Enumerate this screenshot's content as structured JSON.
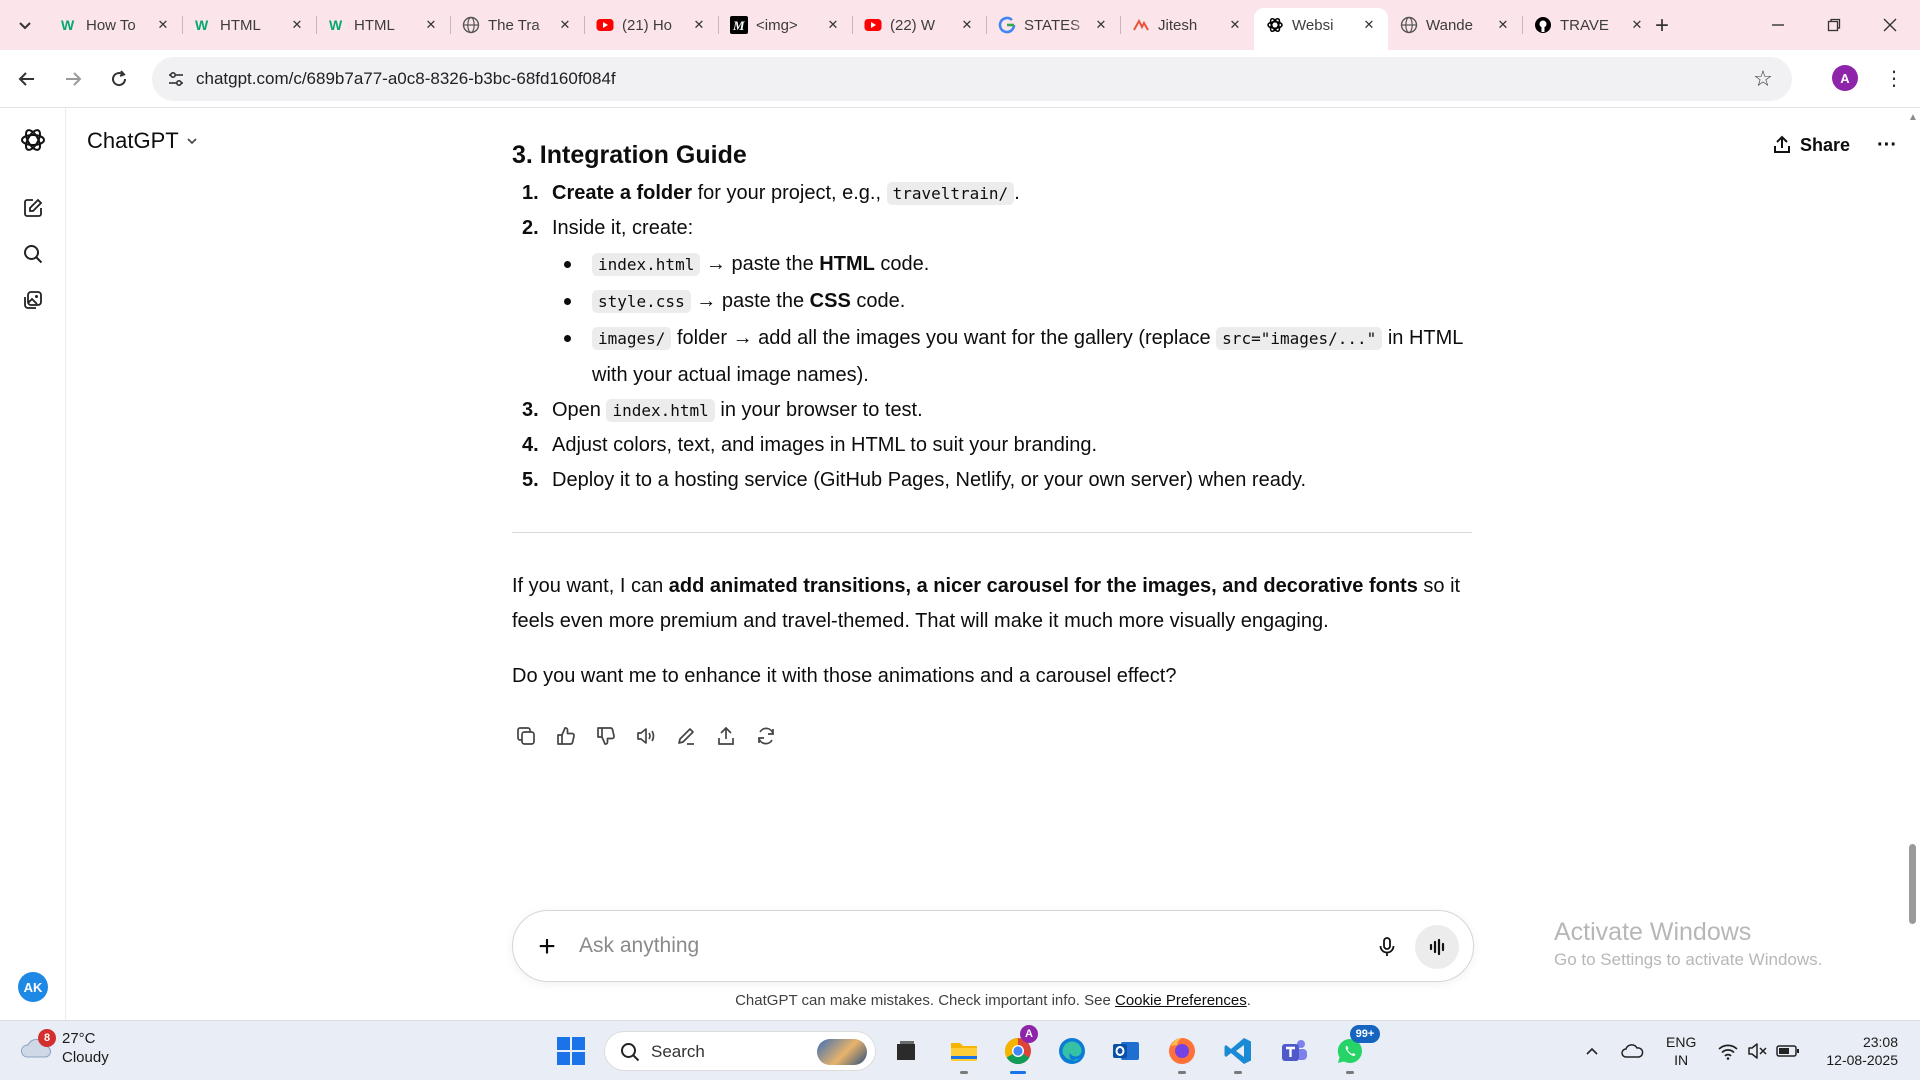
{
  "browser": {
    "tabs": [
      {
        "title": "How To",
        "favicon": "w3schools-icon",
        "color": "#04aa6d"
      },
      {
        "title": "HTML",
        "favicon": "w3schools-icon",
        "color": "#04aa6d"
      },
      {
        "title": "HTML",
        "favicon": "w3schools-icon",
        "color": "#04aa6d"
      },
      {
        "title": "The Tra",
        "favicon": "globe-icon",
        "color": "#555555"
      },
      {
        "title": "(21) Ho",
        "favicon": "youtube-icon",
        "color": "#ff0000"
      },
      {
        "title": "<img>",
        "favicon": "m-logo-icon",
        "color": "#000000"
      },
      {
        "title": "(22) W",
        "favicon": "youtube-icon",
        "color": "#ff0000"
      },
      {
        "title": "STATES",
        "favicon": "google-icon",
        "color": "#4285f4"
      },
      {
        "title": "Jitesh",
        "favicon": "wave-logo-icon",
        "color": "#e8553a"
      },
      {
        "title": "Websi",
        "favicon": "chatgpt-icon",
        "color": "#000000",
        "active": true
      },
      {
        "title": "Wande",
        "favicon": "globe-icon",
        "color": "#555555"
      },
      {
        "title": "TRAVE",
        "favicon": "github-icon",
        "color": "#000000"
      }
    ],
    "url": "chatgpt.com/c/689b7a77-a0c8-8326-b3bc-68fd160f084f",
    "profile_initial": "A"
  },
  "app": {
    "model_name": "ChatGPT",
    "share_label": "Share",
    "user_initials": "AK"
  },
  "message": {
    "heading": "3. Integration Guide",
    "steps": [
      {
        "num": "1.",
        "parts": [
          {
            "b": "Create a folder"
          },
          {
            "t": " for your project, e.g., "
          },
          {
            "c": "traveltrain/"
          },
          {
            "t": "."
          }
        ]
      },
      {
        "num": "2.",
        "parts": [
          {
            "t": "Inside it, create:"
          }
        ],
        "sub": [
          [
            {
              "c": "index.html"
            },
            {
              "t": " → paste the "
            },
            {
              "b": "HTML"
            },
            {
              "t": " code."
            }
          ],
          [
            {
              "c": "style.css"
            },
            {
              "t": " → paste the "
            },
            {
              "b": "CSS"
            },
            {
              "t": " code."
            }
          ],
          [
            {
              "c": "images/"
            },
            {
              "t": " folder → add all the images you want for the gallery (replace "
            },
            {
              "c": "src=\"images/...\""
            },
            {
              "t": " in HTML with your actual image names)."
            }
          ]
        ]
      },
      {
        "num": "3.",
        "parts": [
          {
            "t": "Open "
          },
          {
            "c": "index.html"
          },
          {
            "t": " in your browser to test."
          }
        ]
      },
      {
        "num": "4.",
        "parts": [
          {
            "t": "Adjust colors, text, and images in HTML to suit your branding."
          }
        ]
      },
      {
        "num": "5.",
        "parts": [
          {
            "t": "Deploy it to a hosting service (GitHub Pages, Netlify, or your own server) when ready."
          }
        ]
      }
    ],
    "followup_parts": [
      {
        "t": "If you want, I can "
      },
      {
        "b": "add animated transitions, a nicer carousel for the images, and decorative fonts"
      },
      {
        "t": " so it feels even more premium and travel-themed. That will make it much more visually engaging."
      }
    ],
    "question": "Do you want me to enhance it with those animations and a carousel effect?"
  },
  "composer": {
    "placeholder": "Ask anything",
    "disclaimer_text": "ChatGPT can make mistakes. Check important info. See ",
    "disclaimer_link": "Cookie Preferences",
    "disclaimer_end": "."
  },
  "watermark": {
    "title": "Activate Windows",
    "subtitle": "Go to Settings to activate Windows."
  },
  "taskbar": {
    "weather_badge": "8",
    "temperature": "27°C",
    "condition": "Cloudy",
    "search_label": "Search",
    "chrome_badge": "A",
    "whatsapp_badge": "99+",
    "lang_line1": "ENG",
    "lang_line2": "IN",
    "time": "23:08",
    "date": "12-08-2025"
  }
}
